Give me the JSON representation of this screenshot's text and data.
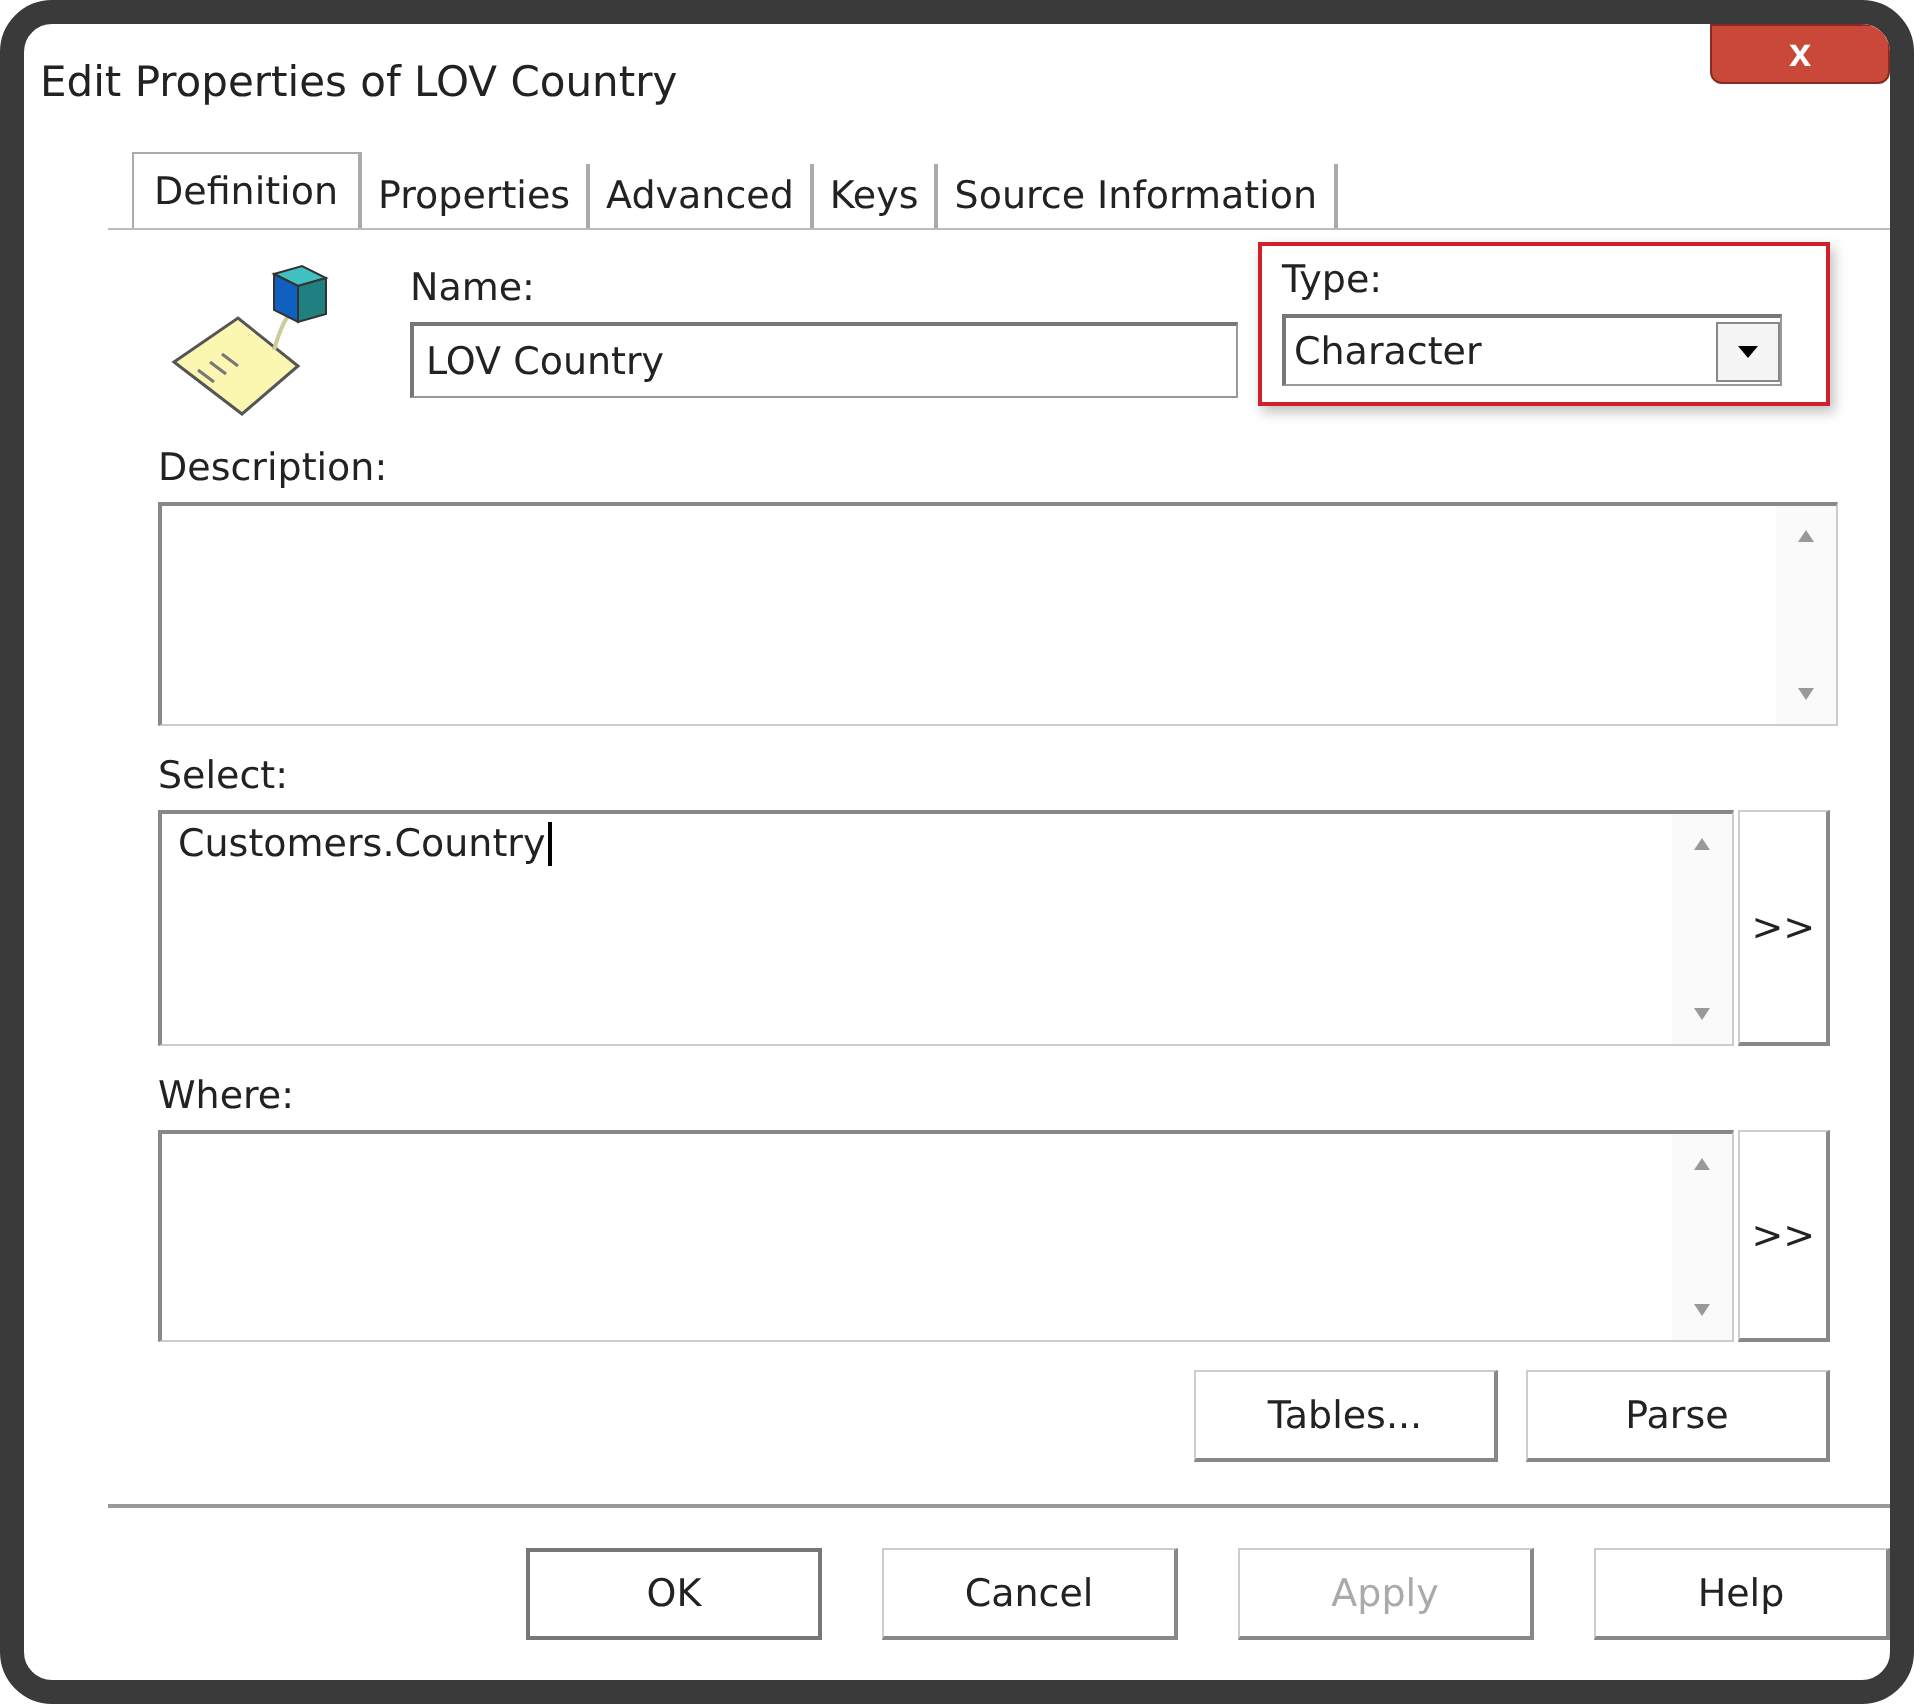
{
  "window": {
    "title": "Edit Properties of LOV Country",
    "close": "x"
  },
  "tabs": [
    {
      "label": "Definition",
      "selected": true
    },
    {
      "label": "Properties",
      "selected": false
    },
    {
      "label": "Advanced",
      "selected": false
    },
    {
      "label": "Keys",
      "selected": false
    },
    {
      "label": "Source Information",
      "selected": false
    }
  ],
  "name": {
    "label": "Name:",
    "value": "LOV Country"
  },
  "type": {
    "label": "Type:",
    "value": "Character",
    "highlighted": true
  },
  "description": {
    "label": "Description:"
  },
  "select": {
    "label": "Select:",
    "value": "Customers.Country",
    "button": ">>"
  },
  "where": {
    "label": "Where:",
    "button": ">>"
  },
  "query_buttons": [
    "Tables...",
    "Parse"
  ],
  "buttons": [
    {
      "label": "OK",
      "default": true,
      "disabled": false
    },
    {
      "label": "Cancel",
      "default": false,
      "disabled": false
    },
    {
      "label": "Apply",
      "default": false,
      "disabled": true
    },
    {
      "label": "Help",
      "default": false,
      "disabled": false
    }
  ]
}
